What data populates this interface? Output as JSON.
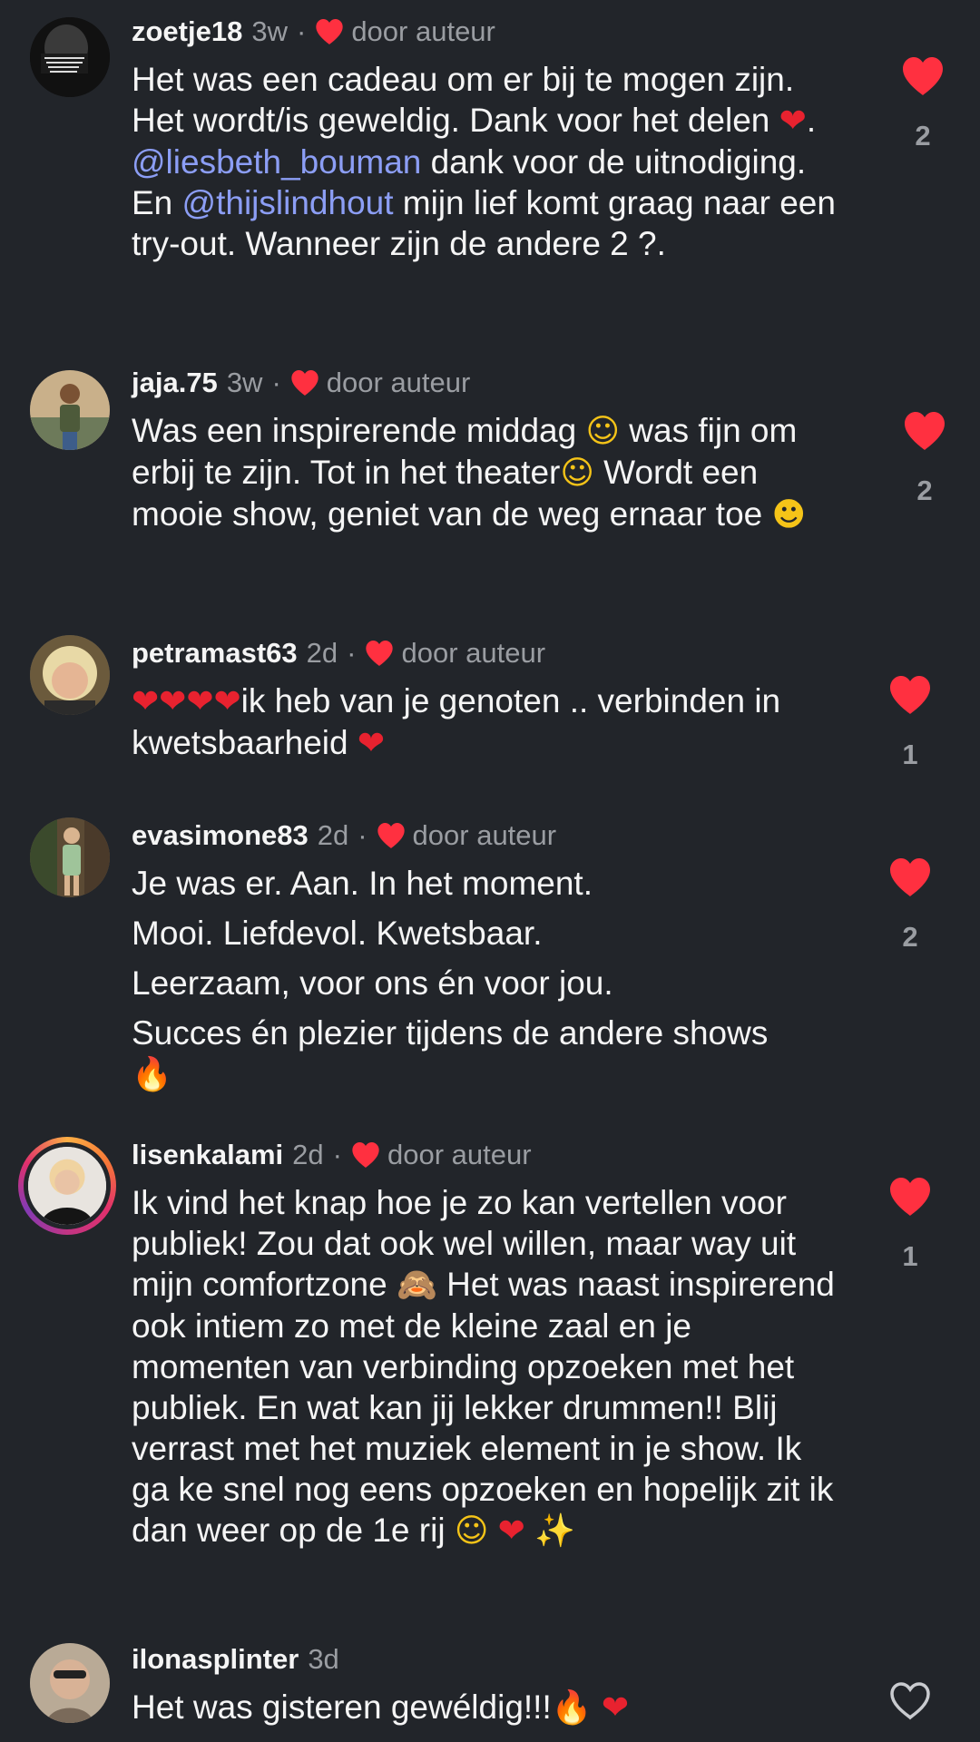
{
  "colors": {
    "background": "#22252a",
    "heart": "#ff3040",
    "mention": "#8c9ef5",
    "secondary_text": "#9a9da2"
  },
  "comments": [
    {
      "username": "zoetje18",
      "time": "3w",
      "liked_by_author": true,
      "author_label": "door auteur",
      "text_parts": [
        "Het was een cadeau om er bij te mogen zijn. Het wordt/is geweldig. Dank voor het delen ",
        ". ",
        "@liesbeth_bouman",
        "  dank voor de uitnodiging. En ",
        "@thijslindhout",
        " mijn lief komt graag naar een try-out. Wanneer zijn de andere 2 ?."
      ],
      "likes": "2",
      "liked": true
    },
    {
      "username": "jaja.75",
      "time": "3w",
      "liked_by_author": true,
      "author_label": "door auteur",
      "text_parts": [
        "Was een inspirerende middag ",
        " was fijn om erbij te zijn. Tot in het theater",
        " Wordt een mooie show, geniet van de weg ernaar toe "
      ],
      "likes": "2",
      "liked": true
    },
    {
      "username": "petramast63",
      "time": "2d",
      "liked_by_author": true,
      "author_label": "door auteur",
      "text_parts": [
        "ik heb van je genoten .. verbinden in kwetsbaarheid "
      ],
      "likes": "1",
      "liked": true
    },
    {
      "username": "evasimone83",
      "time": "2d",
      "liked_by_author": true,
      "author_label": "door auteur",
      "lines": [
        "Je was er. Aan. In het moment.",
        "Mooi. Liefdevol. Kwetsbaar.",
        "Leerzaam, voor ons én voor jou.",
        "Succes én plezier tijdens de andere shows"
      ],
      "likes": "2",
      "liked": true
    },
    {
      "username": "lisenkalami",
      "time": "2d",
      "liked_by_author": true,
      "author_label": "door auteur",
      "text_parts": [
        "Ik vind het knap hoe je zo kan vertellen voor publiek! Zou dat ook wel willen, maar way uit mijn comfortzone ",
        " Het was naast inspirerend ook intiem zo met de kleine zaal en je momenten van verbinding opzoeken met het publiek. En wat kan jij lekker drummen!! Blij verrast met het muziek element in je show. Ik ga ke snel nog eens opzoeken en hopelijk zit ik dan weer op de 1e rij "
      ],
      "likes": "1",
      "liked": true
    },
    {
      "username": "ilonasplinter",
      "time": "3d",
      "liked_by_author": false,
      "text_parts": [
        "Het was gisteren gewéldig!!!"
      ],
      "liked": false
    }
  ]
}
